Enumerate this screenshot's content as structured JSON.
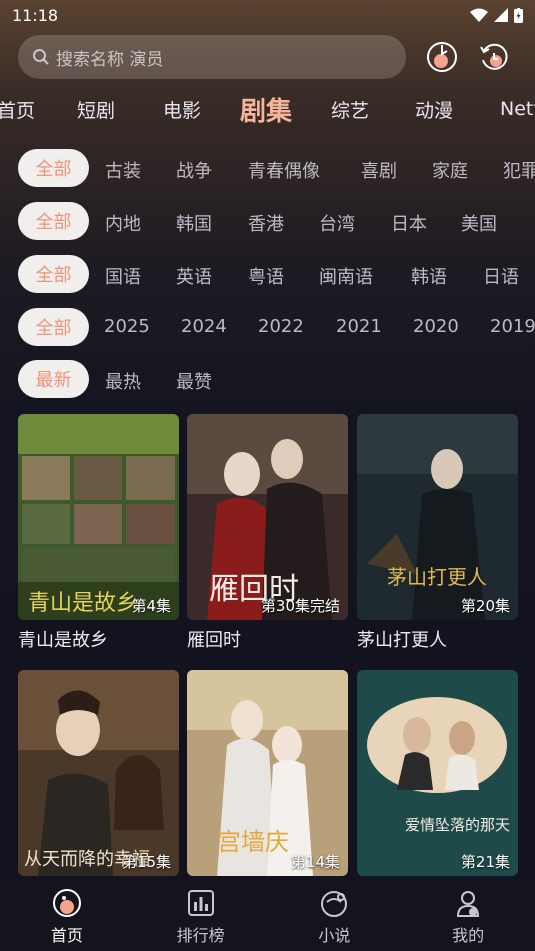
{
  "status": {
    "time": "11:18"
  },
  "search": {
    "placeholder": "搜索名称 演员"
  },
  "top_icons": [
    "history-icon",
    "refresh-icon"
  ],
  "categories": [
    "首页",
    "短剧",
    "电影",
    "剧集",
    "综艺",
    "动漫",
    "Netf"
  ],
  "active_category": "剧集",
  "filters": {
    "genre": {
      "selected": "全部",
      "options": [
        "古装",
        "战争",
        "青春偶像",
        "喜剧",
        "家庭",
        "犯罪"
      ]
    },
    "region": {
      "selected": "全部",
      "options": [
        "内地",
        "韩国",
        "香港",
        "台湾",
        "日本",
        "美国"
      ]
    },
    "language": {
      "selected": "全部",
      "options": [
        "国语",
        "英语",
        "粤语",
        "闽南语",
        "韩语",
        "日语"
      ]
    },
    "year": {
      "selected": "全部",
      "options": [
        "2025",
        "2024",
        "2022",
        "2021",
        "2020",
        "2019"
      ]
    },
    "sort": {
      "selected": "最新",
      "options": [
        "最热",
        "最赞"
      ]
    }
  },
  "cards": [
    {
      "title": "青山是故乡",
      "episode": "第4集",
      "poster_text": "青山是故乡"
    },
    {
      "title": "雁回时",
      "episode": "第30集完结",
      "poster_text": "雁回时"
    },
    {
      "title": "茅山打更人",
      "episode": "第20集",
      "poster_text": "茅山打更人"
    },
    {
      "title": "",
      "episode": "第15集",
      "poster_text": "从天而降的幸福"
    },
    {
      "title": "",
      "episode": "第14集",
      "poster_text": "宫墙庆"
    },
    {
      "title": "",
      "episode": "第21集",
      "poster_text": "爱情坠落的那天"
    }
  ],
  "bottom_nav": [
    {
      "label": "首页",
      "icon": "home-icon",
      "active": true
    },
    {
      "label": "排行榜",
      "icon": "ranking-icon",
      "active": false
    },
    {
      "label": "小说",
      "icon": "novel-icon",
      "active": false
    },
    {
      "label": "我的",
      "icon": "profile-icon",
      "active": false
    }
  ],
  "colors": {
    "accent": "#f5b59a",
    "chip_text": "#f09476",
    "nav_bg": "#15141c"
  }
}
